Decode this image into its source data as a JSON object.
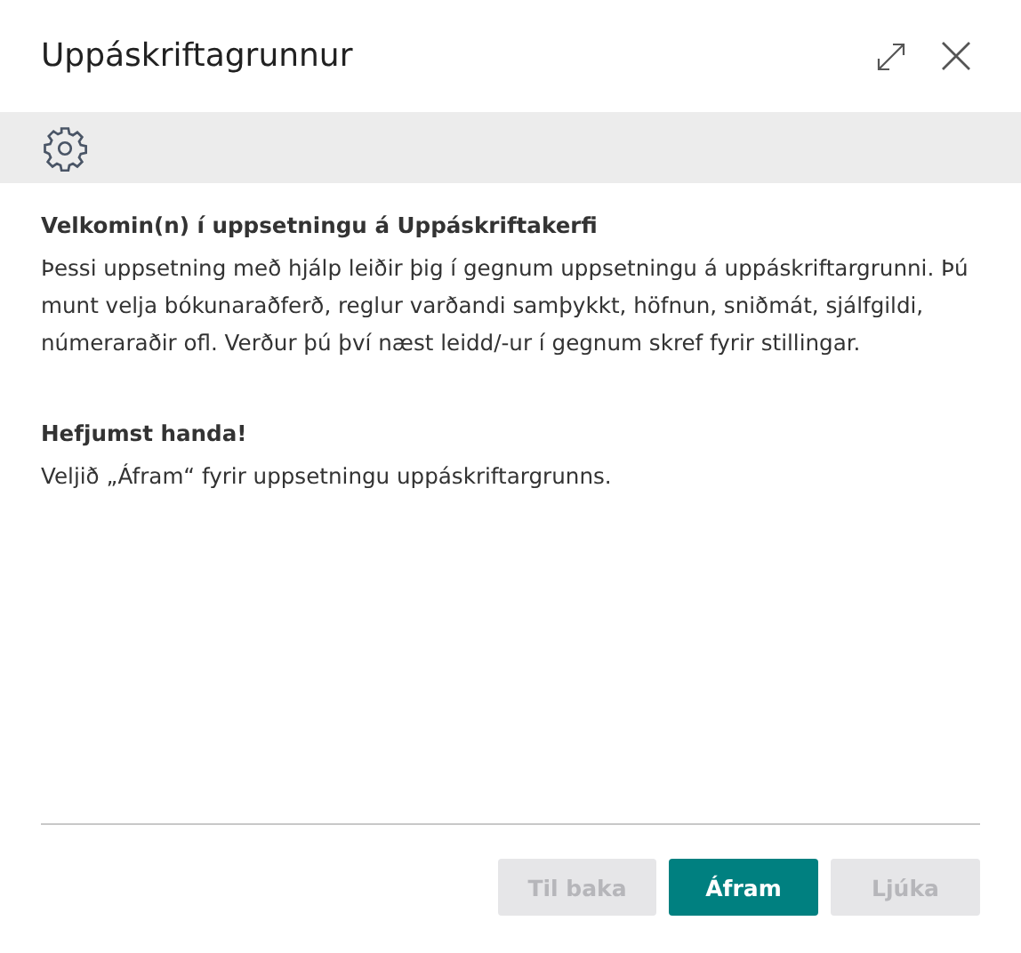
{
  "dialog": {
    "title": "Uppáskriftagrunnur"
  },
  "content": {
    "heading": "Velkomin(n) í uppsetningu á Uppáskriftakerfi",
    "intro": "Þessi uppsetning með hjálp leiðir þig í gegnum uppsetningu á uppáskriftargrunni. Þú munt velja bókunaraðferð, reglur varðandi samþykkt, höfnun, sniðmát, sjálfgildi, númeraraðir ofl. Verður þú því næst leidd/-ur í gegnum skref fyrir stillingar.",
    "subheading": "Hefjumst handa!",
    "instruction": "Veljið „Áfram“ fyrir uppsetningu uppáskriftargrunns."
  },
  "buttons": [
    {
      "label": "Til baka",
      "primary": false,
      "disabled": true
    },
    {
      "label": "Áfram",
      "primary": true,
      "disabled": false
    },
    {
      "label": "Ljúka",
      "primary": false,
      "disabled": true
    }
  ]
}
